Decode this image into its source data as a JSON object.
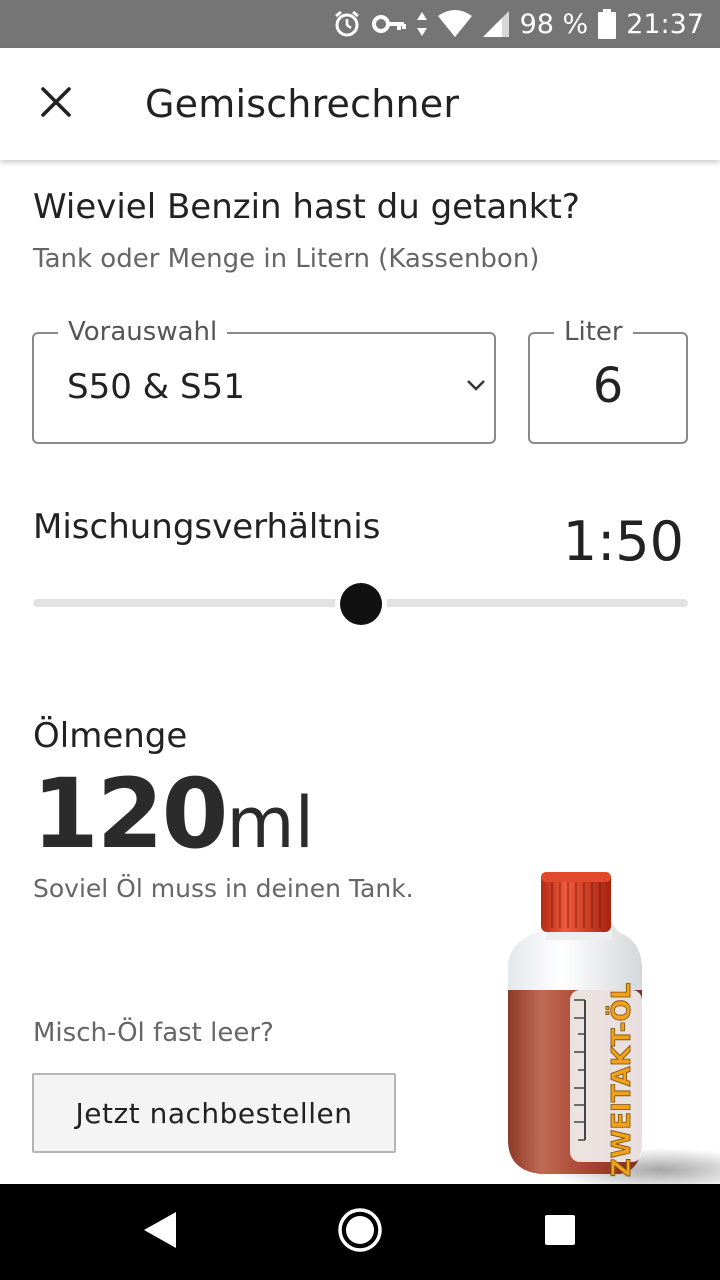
{
  "status_bar": {
    "battery_percent": "98 %",
    "time": "21:37",
    "icons": [
      "alarm-icon",
      "vpn-key-icon",
      "data-arrows-icon",
      "wifi-icon",
      "signal-icon",
      "battery-icon"
    ]
  },
  "app_bar": {
    "title": "Gemischrechner",
    "close_icon": "close-icon"
  },
  "question": {
    "title": "Wieviel Benzin hast du getankt?",
    "subtitle": "Tank oder Menge in Litern (Kassenbon)"
  },
  "preset": {
    "label": "Vorauswahl",
    "value": "S50 & S51"
  },
  "liter": {
    "label": "Liter",
    "value": "6"
  },
  "mix_ratio": {
    "label": "Mischungsverhältnis",
    "value": "1:50",
    "slider_fraction": 0.5
  },
  "oil": {
    "label": "Ölmenge",
    "amount": "120",
    "unit": "ml",
    "subtitle": "Soviel Öl muss in deinen Tank."
  },
  "reorder": {
    "question": "Misch-Öl fast leer?",
    "button_label": "Jetzt nachbestellen"
  },
  "bottle": {
    "label": "ZWEITAKT-ÖL",
    "cap_color": "#d93b22",
    "oil_color": "#b04a35"
  },
  "nav_bar": {
    "icons": [
      "back-icon",
      "home-icon",
      "recents-icon"
    ]
  }
}
